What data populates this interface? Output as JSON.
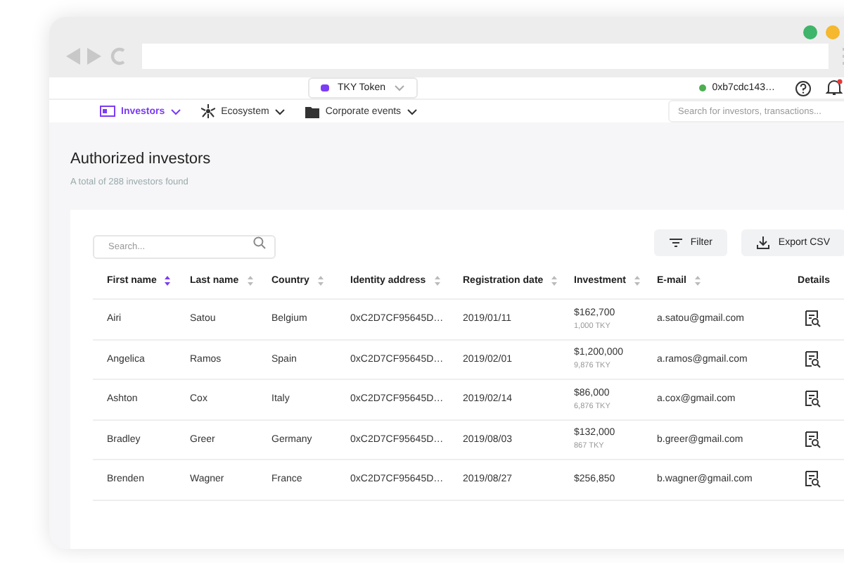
{
  "token_selector": {
    "label": "TKY Token"
  },
  "wallet": {
    "address": "0xb7cdc143…",
    "connected": true
  },
  "notifications": {
    "unread": true
  },
  "nav": [
    {
      "label": "Investors",
      "selected": true,
      "kind": "investors"
    },
    {
      "label": "Ecosystem",
      "selected": false,
      "kind": "ecosystem"
    },
    {
      "label": "Corporate events",
      "selected": false,
      "kind": "events"
    }
  ],
  "global_search": {
    "placeholder": "Search for investors, transactions..."
  },
  "page": {
    "title": "Authorized investors",
    "subtitle": "A total of 288 investors found"
  },
  "table_search": {
    "placeholder": "Search..."
  },
  "buttons": [
    {
      "label": "Filter",
      "kind": "filter"
    },
    {
      "label": "Export CSV",
      "kind": "export"
    }
  ],
  "table": {
    "columns": [
      {
        "label": "First name",
        "sorted": true
      },
      {
        "label": "Last name",
        "sorted": false
      },
      {
        "label": "Country",
        "sorted": false
      },
      {
        "label": "Identity address",
        "sorted": false
      },
      {
        "label": "Registration date",
        "sorted": false
      },
      {
        "label": "Investment",
        "sorted": false
      },
      {
        "label": "E-mail",
        "sorted": false
      },
      {
        "label": "Details"
      }
    ],
    "rows": [
      {
        "first": "Airi",
        "last": "Satou",
        "country": "Belgium",
        "address": "0xC2D7CF95645D…",
        "date": "2019/01/11",
        "amount": "$162,700",
        "tokens": "1,000 TKY",
        "email": "a.satou@gmail.com"
      },
      {
        "first": "Angelica",
        "last": "Ramos",
        "country": "Spain",
        "address": "0xC2D7CF95645D…",
        "date": "2019/02/01",
        "amount": "$1,200,000",
        "tokens": "9,876 TKY",
        "email": "a.ramos@gmail.com"
      },
      {
        "first": "Ashton",
        "last": "Cox",
        "country": "Italy",
        "address": "0xC2D7CF95645D…",
        "date": "2019/02/14",
        "amount": "$86,000",
        "tokens": "6,876 TKY",
        "email": "a.cox@gmail.com"
      },
      {
        "first": "Bradley",
        "last": "Greer",
        "country": "Germany",
        "address": "0xC2D7CF95645D…",
        "date": "2019/08/03",
        "amount": "$132,000",
        "tokens": "867 TKY",
        "email": "b.greer@gmail.com"
      },
      {
        "first": "Brenden",
        "last": "Wagner",
        "country": "France",
        "address": "0xC2D7CF95645D…",
        "date": "2019/08/27",
        "amount": "$256,850",
        "email": "b.wagner@gmail.com"
      }
    ]
  }
}
